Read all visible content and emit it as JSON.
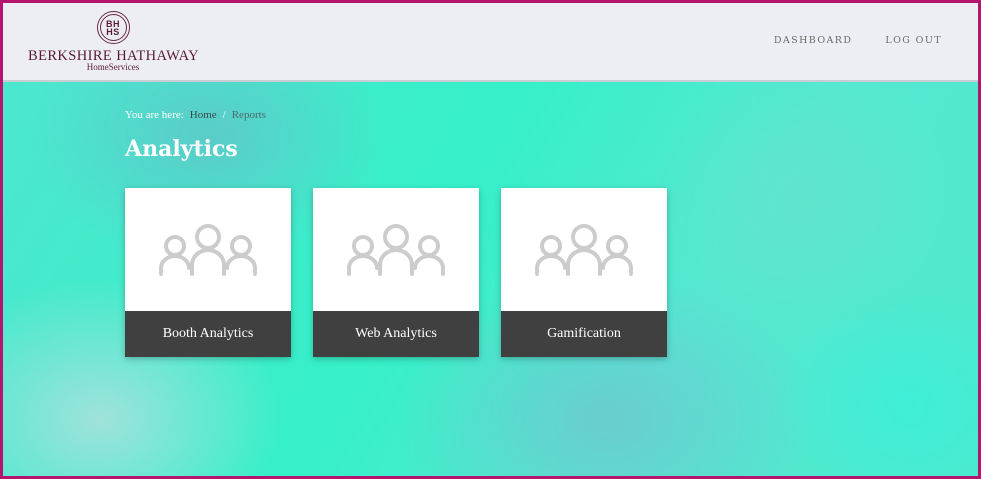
{
  "header": {
    "logo": {
      "seal_line1": "BH",
      "seal_line2": "HS",
      "name": "BERKSHIRE HATHAWAY",
      "sub": "HomeServices"
    },
    "nav": [
      {
        "label": "DASHBOARD"
      },
      {
        "label": "LOG OUT"
      }
    ]
  },
  "breadcrumb": {
    "prefix": "You are here:",
    "home": "Home",
    "separator": "/",
    "current": "Reports"
  },
  "page_title": "Analytics",
  "cards": [
    {
      "label": "Booth Analytics",
      "icon": "group-icon"
    },
    {
      "label": "Web Analytics",
      "icon": "group-icon"
    },
    {
      "label": "Gamification",
      "icon": "group-icon"
    }
  ],
  "colors": {
    "frame_border": "#b5156f",
    "header_bg": "#eceef3",
    "brand": "#5a1a36",
    "card_label_bg": "#404040",
    "icon_gray": "#cccccc"
  }
}
